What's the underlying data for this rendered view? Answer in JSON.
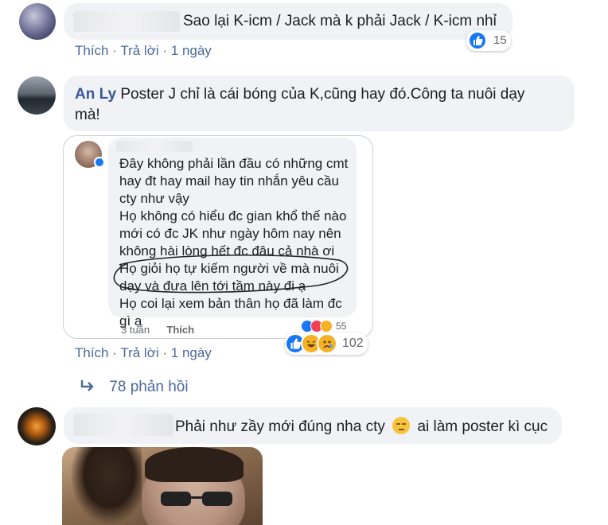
{
  "comments": [
    {
      "text": "Sao lại K-icm / Jack mà k phải Jack / K-icm nhỉ",
      "actions": {
        "like": "Thích",
        "reply": "Trả lời",
        "time": "1 ngày"
      },
      "reaction_count": "15"
    },
    {
      "author": "An Ly",
      "text_line1": "Poster J chỉ là cái bóng của K,cũng hay đó.Công ta nuôi dạy",
      "text_line2": "mà!",
      "actions": {
        "like": "Thích",
        "reply": "Trả lời",
        "time": "1 ngày"
      },
      "reaction_count": "102",
      "replies_label": "78 phản hồi"
    },
    {
      "text": "Phải như zầy mới đúng nha cty",
      "text_after_emoji": "ai làm poster kì cục"
    }
  ],
  "embedded_screenshot": {
    "lines": [
      "Đây không phải lần đầu có những cmt",
      "hay đt hay mail hay tin nhắn yêu cầu",
      "cty như vậy",
      "Họ không có hiểu đc gian khổ thế nào",
      "mới có đc JK như ngày hôm nay nên",
      "không hài lòng hết đc đâu cả nhà ơi",
      "Họ giỏi họ tự kiếm người về mà nuôi",
      "dạy và đưa lên tới tầm này đi ạ",
      "Họ coi lại xem bản thân họ đã làm đc",
      "gì ạ"
    ],
    "time": "3 tuần",
    "like": "Thích",
    "reaction_count": "55"
  },
  "colors": {
    "bubble": "#f0f2f5",
    "author": "#385898",
    "meta": "#65676b",
    "like_blue": "#1877f2",
    "love_red": "#f33e58",
    "haha_yellow": "#f7b125"
  }
}
